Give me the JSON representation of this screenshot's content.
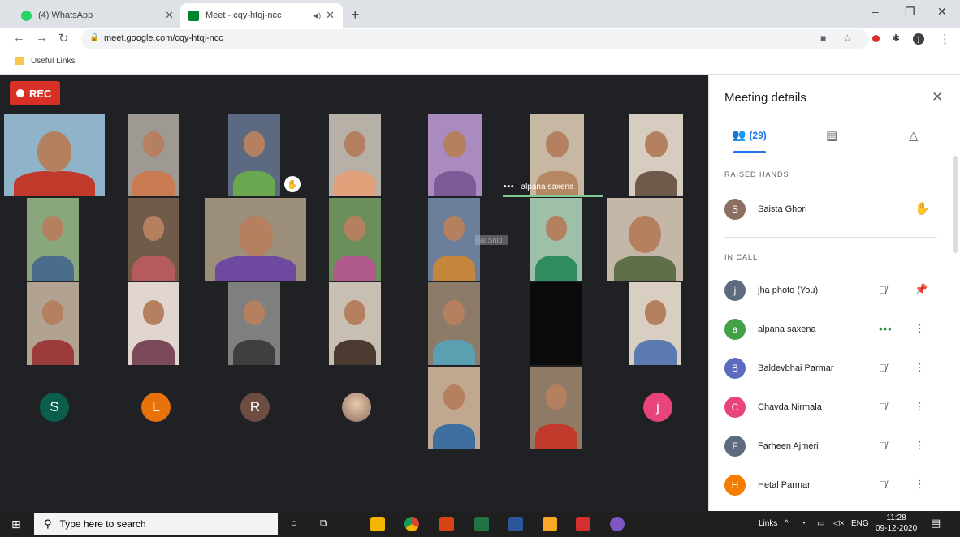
{
  "browser": {
    "tabs": [
      {
        "title": "(4) WhatsApp",
        "favicon_color": "#25d366",
        "active": false
      },
      {
        "title": "Meet - cqy-htqj-ncc",
        "favicon_color": "#00832d",
        "active": true
      }
    ],
    "url": "meet.google.com/cqy-htqj-ncc",
    "bookmarks": [
      {
        "label": "Useful Links"
      }
    ],
    "profile_initial": "j"
  },
  "meeting": {
    "rec_label": "REC",
    "speaking_name": "alpana saxena",
    "overlay_text": "ai Snip",
    "avatar_tiles": [
      {
        "letter": "S",
        "color": "#0b5e4b"
      },
      {
        "letter": "L",
        "color": "#e8710a"
      },
      {
        "letter": "R",
        "color": "#6d4c41"
      },
      {
        "letter": "",
        "color": "#c5a28a"
      },
      {
        "letter": "j",
        "color": "#e8437a"
      }
    ]
  },
  "panel": {
    "title": "Meeting details",
    "people_count": "(29)",
    "raised_hands_label": "RAISED HANDS",
    "in_call_label": "IN CALL",
    "raised_hands": [
      {
        "name": "Saista Ghori",
        "initial": "S",
        "color": "#8d6e63"
      }
    ],
    "participants": [
      {
        "name": "jha photo (You)",
        "initial": "j",
        "color": "#5e6a7e"
      },
      {
        "name": "alpana saxena",
        "initial": "a",
        "color": "#43a047"
      },
      {
        "name": "Baldevbhai Parmar",
        "initial": "B",
        "color": "#5c6bc0"
      },
      {
        "name": "Chavda Nirmala",
        "initial": "C",
        "color": "#e8437a"
      },
      {
        "name": "Farheen Ajmeri",
        "initial": "F",
        "color": "#5e6a7e"
      },
      {
        "name": "Hetal Parmar",
        "initial": "H",
        "color": "#f57c00"
      }
    ]
  },
  "taskbar": {
    "search_placeholder": "Type here to search",
    "links_label": "Links",
    "lang": "ENG",
    "time": "11:28",
    "date": "09-12-2020"
  }
}
